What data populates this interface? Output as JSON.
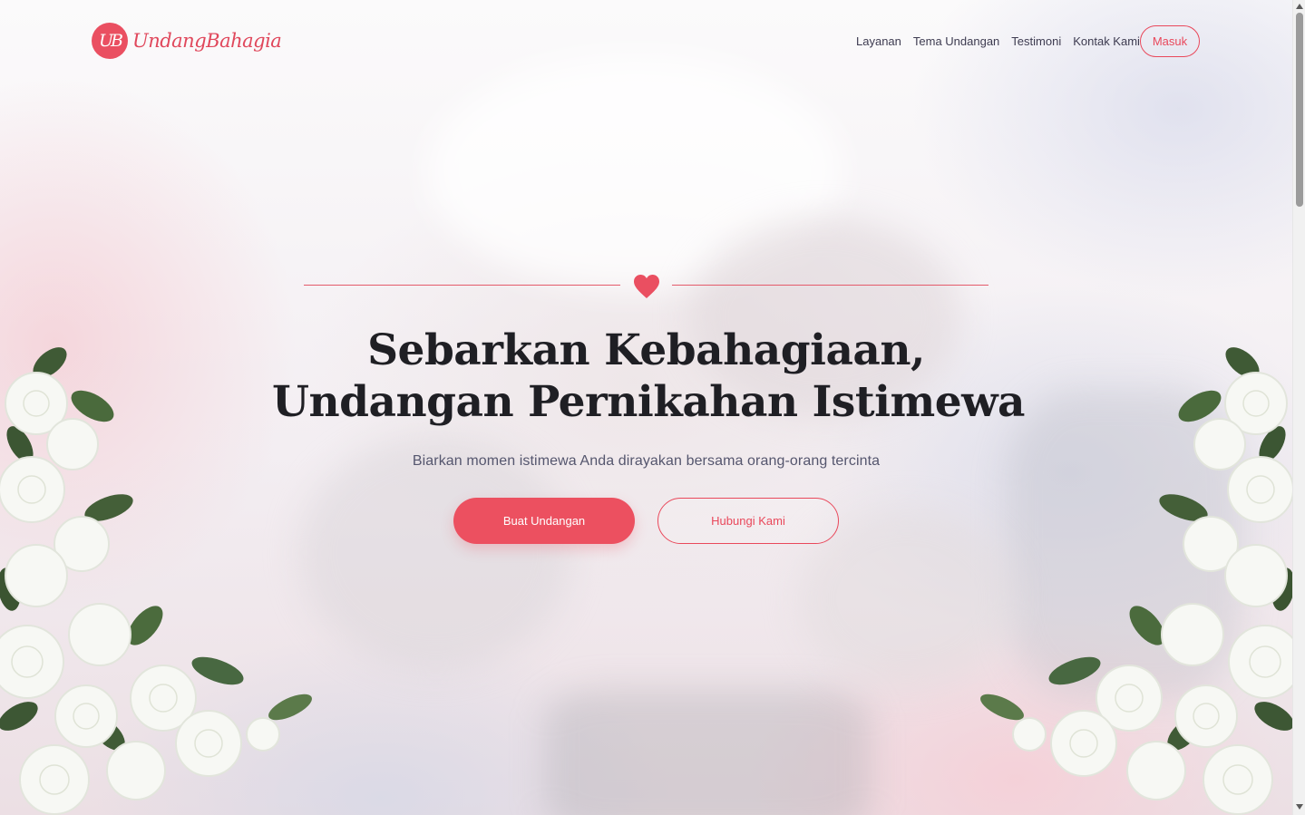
{
  "brand": {
    "monogram": "UB",
    "name": "UndangBahagia"
  },
  "nav": {
    "links": [
      "Layanan",
      "Tema Undangan",
      "Testimoni",
      "Kontak Kami"
    ],
    "login_label": "Masuk"
  },
  "hero": {
    "headline_line1": "Sebarkan Kebahagiaan,",
    "headline_line2": "Undangan Pernikahan Istimewa",
    "subtitle": "Biarkan momen istimewa Anda dirayakan bersama orang-orang tercinta",
    "primary_button": "Buat Undangan",
    "secondary_button": "Hubungi Kami",
    "divider_icon": "heart-icon"
  },
  "colors": {
    "accent": "#ea4f61",
    "heading": "#1f1f24",
    "text": "#3d3b50"
  },
  "decorations": {
    "left": "white-rose-bouquet",
    "right": "white-rose-bouquet"
  }
}
